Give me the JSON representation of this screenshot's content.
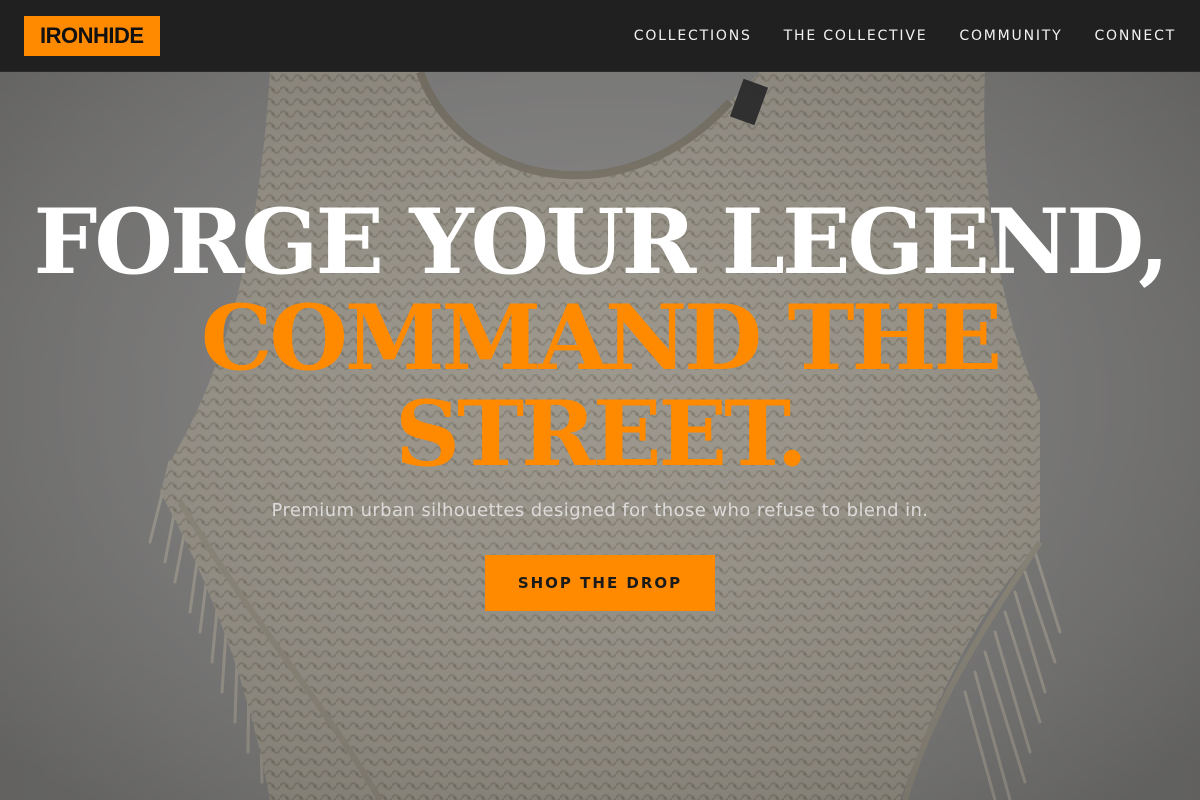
{
  "brand": {
    "logo_text": "IRONHIDE"
  },
  "nav": {
    "items": [
      {
        "label": "COLLECTIONS"
      },
      {
        "label": "THE COLLECTIVE"
      },
      {
        "label": "COMMUNITY"
      },
      {
        "label": "CONNECT"
      }
    ]
  },
  "hero": {
    "headline_line1": "FORGE YOUR LEGEND,",
    "headline_line2": "COMMAND THE STREET.",
    "subtitle": "Premium urban silhouettes designed for those who refuse to blend in.",
    "cta_label": "SHOP THE DROP",
    "image_subject": "knit-fringe-poncho-on-hanger"
  },
  "colors": {
    "accent": "#ff8a00",
    "header_bg": "#202020",
    "headline_primary": "#ffffff"
  }
}
